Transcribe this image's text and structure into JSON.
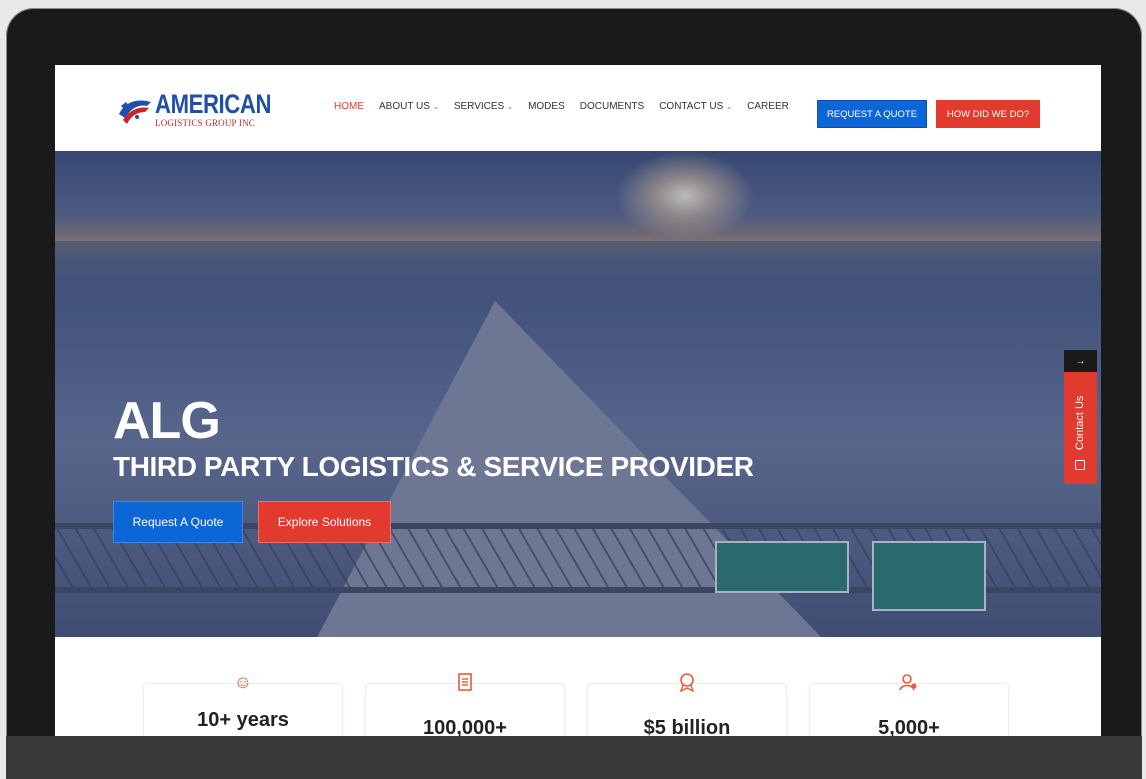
{
  "header": {
    "logo_main": "AMERICAN",
    "logo_sub": "LOGISTICS GROUP INC"
  },
  "nav": {
    "items": [
      {
        "label": "HOME",
        "active": true,
        "dropdown": false
      },
      {
        "label": "ABOUT US",
        "active": false,
        "dropdown": true
      },
      {
        "label": "SERVICES",
        "active": false,
        "dropdown": true
      },
      {
        "label": "MODES",
        "active": false,
        "dropdown": false
      },
      {
        "label": "DOCUMENTS",
        "active": false,
        "dropdown": false
      },
      {
        "label": "CONTACT US",
        "active": false,
        "dropdown": true
      },
      {
        "label": "CAREER",
        "active": false,
        "dropdown": false
      }
    ],
    "quote_button": "REQUEST A QUOTE",
    "how_button": "HOW DID WE DO?"
  },
  "hero": {
    "title": "ALG",
    "subtitle": "THIRD PARTY LOGISTICS & SERVICE PROVIDER",
    "quote_button": "Request A Quote",
    "explore_button": "Explore Solutions"
  },
  "contact_tab": {
    "label": "Contact Us"
  },
  "stats": [
    {
      "icon": "smile-icon",
      "value": "10+ years"
    },
    {
      "icon": "document-icon",
      "value": "100,000+"
    },
    {
      "icon": "award-icon",
      "value": "$5 billion"
    },
    {
      "icon": "users-icon",
      "value": "5,000+"
    }
  ],
  "colors": {
    "brand_blue": "#0d66d6",
    "brand_red": "#e23a2e",
    "nav_active": "#e8392d"
  }
}
